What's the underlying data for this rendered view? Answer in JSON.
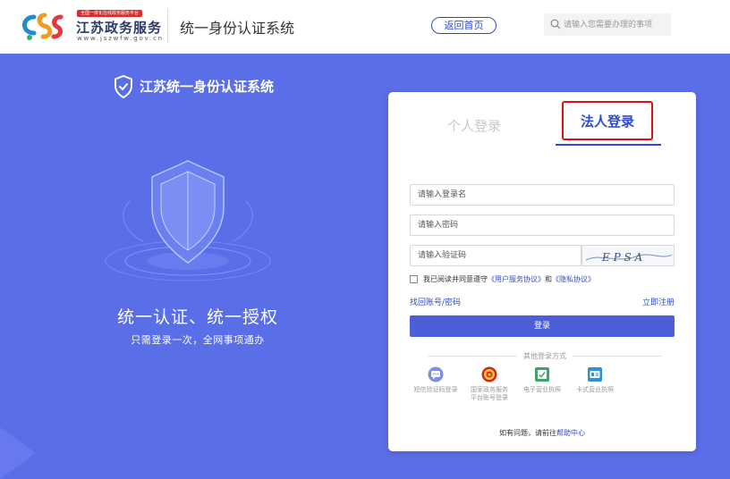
{
  "header": {
    "logo_slogan": "全国一体化在线政务服务平台",
    "logo_name": "江苏政务服务",
    "logo_url": "www.jszwfw.gov.cn",
    "title": "统一身份认证系统",
    "home_button": "返回首页",
    "search_placeholder": "请输入您需要办理的事项"
  },
  "hero": {
    "title": "江苏统一身份认证系统",
    "slogan": "统一认证、统一授权",
    "subslogan": "只需登录一次，全网事项通办"
  },
  "login": {
    "tabs": [
      {
        "label": "个人登录",
        "active": false
      },
      {
        "label": "法人登录",
        "active": true
      }
    ],
    "username_placeholder": "请输入登录名",
    "password_placeholder": "请输入密码",
    "captcha_placeholder": "请输入验证码",
    "captcha_text": "E P S A",
    "agree_prefix": "我已阅读并同意遵守",
    "agree_link_service": "《用户服务协议》",
    "agree_and": "和",
    "agree_link_privacy": "《隐私协议》",
    "forgot_label": "找回账号/密码",
    "register_label": "立即注册",
    "login_button": "登录",
    "other_methods_title": "其他登录方式",
    "other_methods": [
      {
        "label": "短信验证码登录",
        "icon": "chat-bubble-icon"
      },
      {
        "label": "国家政务服务",
        "label2": "平台账号登录",
        "icon": "national-emblem-icon"
      },
      {
        "label": "电子营业执照",
        "icon": "e-license-icon"
      },
      {
        "label": "卡式营业执照",
        "icon": "card-license-icon"
      }
    ],
    "help_prefix": "如有问题，请前往",
    "help_link": "帮助中心"
  },
  "colors": {
    "background": "#5a6ee8",
    "accent": "#2e4bd0",
    "button": "#4c5fd7",
    "highlight": "#e01010"
  }
}
